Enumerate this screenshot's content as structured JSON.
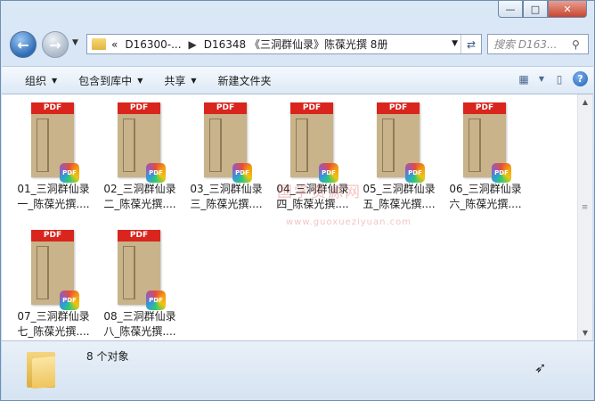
{
  "window": {
    "controls": {
      "minimize": "—",
      "maximize": "□",
      "close": "✕"
    }
  },
  "nav": {
    "breadcrumb_overflow": "«",
    "breadcrumb": [
      "D16300-...",
      "D16348 《三洞群仙录》陈葆光撰 8册"
    ],
    "search_placeholder": "搜索 D163..."
  },
  "toolbar": {
    "items": [
      "组织",
      "包含到库中",
      "共享",
      "新建文件夹"
    ]
  },
  "files": [
    {
      "line1": "01_三洞群仙录",
      "line2": "一_陈葆光撰...."
    },
    {
      "line1": "02_三洞群仙录",
      "line2": "二_陈葆光撰...."
    },
    {
      "line1": "03_三洞群仙录",
      "line2": "三_陈葆光撰...."
    },
    {
      "line1": "04_三洞群仙录",
      "line2": "四_陈葆光撰...."
    },
    {
      "line1": "05_三洞群仙录",
      "line2": "五_陈葆光撰...."
    },
    {
      "line1": "06_三洞群仙录",
      "line2": "六_陈葆光撰...."
    },
    {
      "line1": "07_三洞群仙录",
      "line2": "七_陈葆光撰...."
    },
    {
      "line1": "08_三洞群仙录",
      "line2": "八_陈葆光撰...."
    }
  ],
  "file_icon": {
    "band": "PDF",
    "badge": "PDF"
  },
  "status": {
    "count_text": "8 个对象"
  },
  "watermark": {
    "text": "国学资源网",
    "url": "www.guoxueziyuan.com"
  }
}
